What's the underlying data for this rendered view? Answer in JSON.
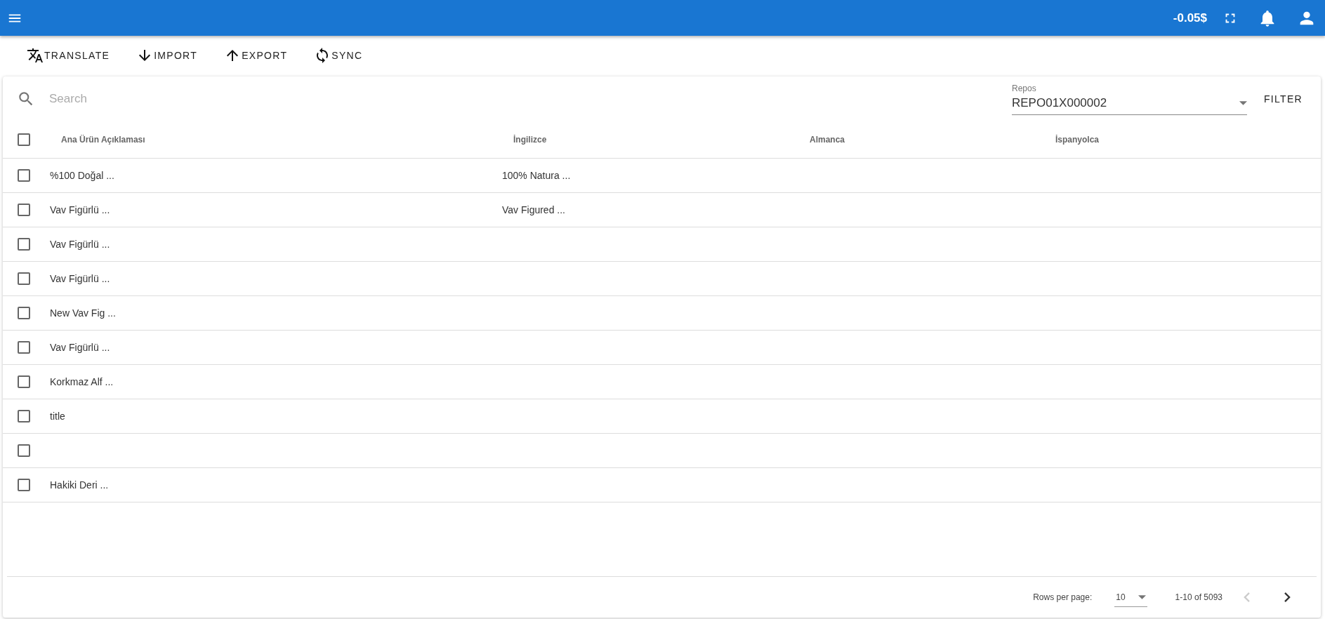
{
  "app_bar": {
    "balance": "-0.05$"
  },
  "toolbar": [
    "TRANSLATE",
    "IMPORT",
    "EXPORT",
    "SYNC"
  ],
  "search": {
    "placeholder": "Search"
  },
  "repos": {
    "label": "Repos",
    "value": "REPO01X000002"
  },
  "filter_button": "FILTER",
  "table": {
    "select_all": {
      "checked": false
    },
    "columns": [
      "Ana Ürün Açıklaması",
      "İngilizce",
      "Almanca",
      "İspanyolca"
    ],
    "rows": [
      {
        "checked": false,
        "cells": [
          "%100 Doğal ...",
          "100% Natura ...",
          "",
          ""
        ]
      },
      {
        "checked": false,
        "cells": [
          "Vav Figürlü ...",
          "Vav Figured ...",
          "",
          ""
        ]
      },
      {
        "checked": false,
        "cells": [
          "Vav Figürlü ...",
          "",
          "",
          ""
        ]
      },
      {
        "checked": false,
        "cells": [
          "Vav Figürlü ...",
          "",
          "",
          ""
        ]
      },
      {
        "checked": false,
        "cells": [
          "New Vav Fig ...",
          "",
          "",
          ""
        ]
      },
      {
        "checked": false,
        "cells": [
          "Vav Figürlü ...",
          "",
          "",
          ""
        ]
      },
      {
        "checked": false,
        "cells": [
          "Korkmaz Alf ...",
          "",
          "",
          ""
        ]
      },
      {
        "checked": false,
        "cells": [
          "title",
          "",
          "",
          ""
        ]
      },
      {
        "checked": false,
        "cells": [
          "",
          "",
          "",
          ""
        ]
      },
      {
        "checked": false,
        "cells": [
          "Hakiki Deri ...",
          "",
          "",
          ""
        ]
      }
    ]
  },
  "pagination": {
    "rows_per_page_label": "Rows per page:",
    "rows_per_page": "10",
    "range": "1-10 of 5093",
    "previous_disabled": true,
    "next_disabled": false
  }
}
